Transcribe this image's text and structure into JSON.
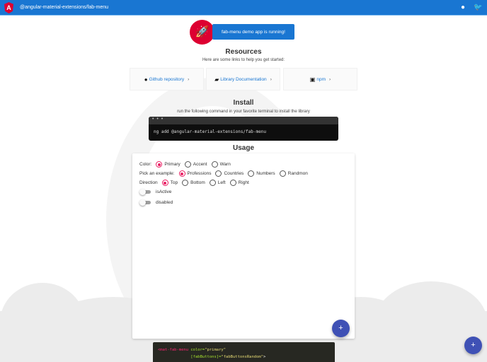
{
  "header": {
    "title": "@angular-material-extensions/fab-menu",
    "logo": "A"
  },
  "banner": {
    "running": "fab-menu demo app is running!"
  },
  "resources": {
    "title": "Resources",
    "subtitle": "Here are some links to help you get started:",
    "links": [
      {
        "label": "Github repository",
        "icon": "github-icon"
      },
      {
        "label": "Library Documentation",
        "icon": "book-icon"
      },
      {
        "label": "npm",
        "icon": "npm-icon"
      }
    ]
  },
  "install": {
    "title": "Install",
    "subtitle": "run the following command in your favorite terminal to install the library",
    "dots": "• • •",
    "command": "ng add @angular-material-extensions/fab-menu"
  },
  "usage": {
    "title": "Usage",
    "color": {
      "label": "Color:",
      "options": [
        "Primary",
        "Accent",
        "Warn"
      ],
      "selected": 0
    },
    "example": {
      "label": "Pick an example:",
      "options": [
        "Professions",
        "Countries",
        "Numbers",
        "Randmon"
      ],
      "selected": 0
    },
    "direction": {
      "label": "Direction",
      "options": [
        "Top",
        "Bottom",
        "Left",
        "Right"
      ],
      "selected": 0
    },
    "toggles": [
      "isActive",
      "disabled"
    ]
  },
  "code": {
    "tag": "<mat-fab-menu",
    "attr1": " color=",
    "val1": "\"primary\"",
    "attr2": "[fabButtons]=",
    "val2": "\"fabButtonsRandom\"",
    "end": ">"
  },
  "fab": {
    "symbol": "+"
  },
  "colors": {
    "primary": "#1976d2",
    "angular": "#dd0031",
    "fab": "#3f51b5",
    "accent": "#e91e63"
  }
}
